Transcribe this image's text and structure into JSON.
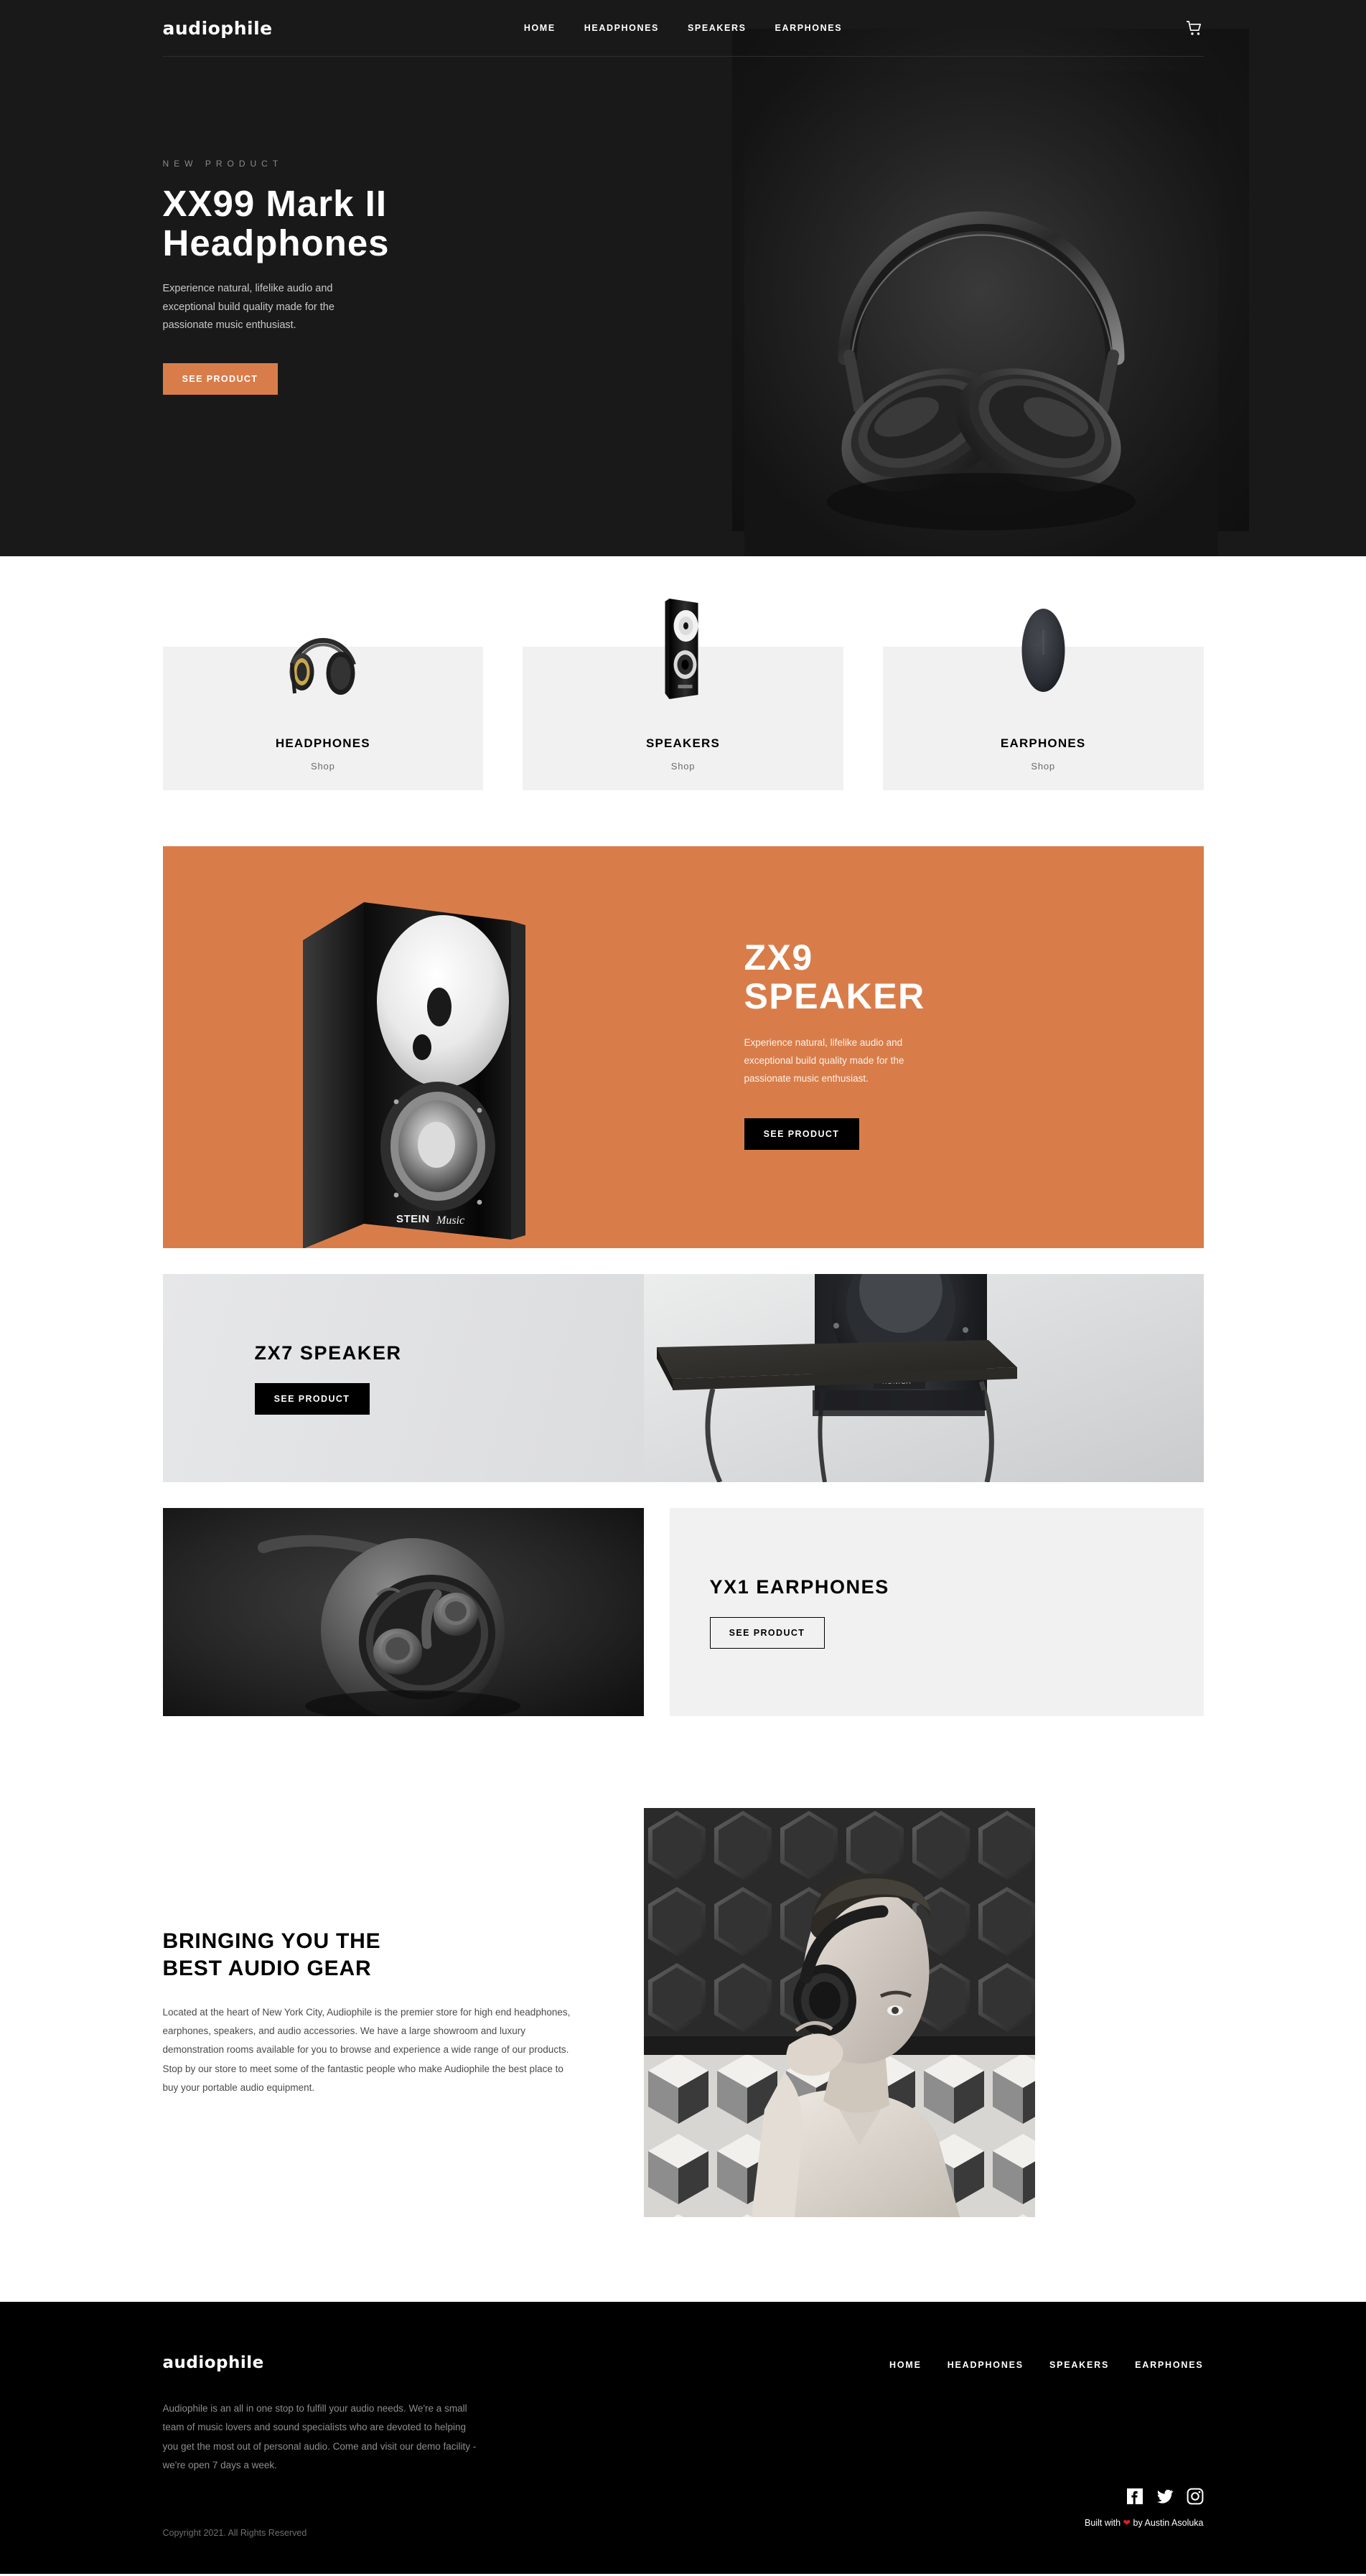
{
  "brand": {
    "name": "audiophile"
  },
  "header": {
    "nav": [
      {
        "label": "HOME"
      },
      {
        "label": "HEADPHONES"
      },
      {
        "label": "SPEAKERS"
      },
      {
        "label": "EARPHONES"
      }
    ],
    "cart_icon": "shopping-cart-icon"
  },
  "hero": {
    "overline": "NEW PRODUCT",
    "title_line1": "XX99 Mark II",
    "title_line2": "Headphones",
    "description": "Experience natural, lifelike audio and exceptional build quality made for the passionate music enthusiast.",
    "cta": "SEE PRODUCT",
    "cta_color": "#D87D4A",
    "background_color": "#191919",
    "image": "xx99-mark-ii-headphones-photo"
  },
  "categories": [
    {
      "name": "HEADPHONES",
      "shop": "Shop",
      "image": "headphones-product-image"
    },
    {
      "name": "SPEAKERS",
      "shop": "Shop",
      "image": "speaker-product-image"
    },
    {
      "name": "EARPHONES",
      "shop": "Shop",
      "image": "earphones-product-image"
    }
  ],
  "zx9": {
    "title_line1": "ZX9",
    "title_line2": "SPEAKER",
    "description": "Experience natural, lifelike audio and exceptional build quality made for the passionate music enthusiast.",
    "cta": "SEE PRODUCT",
    "background_color": "#D87D4A",
    "image": "zx9-speaker-photo",
    "image_brand": "STEIN Music"
  },
  "zx7": {
    "title": "ZX7 SPEAKER",
    "cta": "SEE PRODUCT",
    "image": "zx7-speaker-photo"
  },
  "yx1": {
    "title": "YX1 EARPHONES",
    "cta": "SEE PRODUCT",
    "image": "yx1-earphones-photo"
  },
  "about": {
    "title_line1": "BRINGING YOU THE",
    "title_line2": "BEST AUDIO GEAR",
    "text": "Located at the heart of New York City, Audiophile is the premier store for high end headphones, earphones, speakers, and audio accessories. We have a large showroom and luxury demonstration rooms available for you to browse and experience a wide range of our products. Stop by our store to meet some of the fantastic people who make Audiophile the best place to buy your portable audio equipment.",
    "image": "man-wearing-headphones-photo"
  },
  "footer": {
    "logo": "audiophile",
    "nav": [
      {
        "label": "HOME"
      },
      {
        "label": "HEADPHONES"
      },
      {
        "label": "SPEAKERS"
      },
      {
        "label": "EARPHONES"
      }
    ],
    "description": "Audiophile is an all in one stop to fulfill your audio needs. We're a small team of music lovers and sound specialists who are devoted to helping you get the most out of personal audio. Come and visit our demo facility - we're open 7 days a week.",
    "socials": [
      {
        "name": "facebook-icon"
      },
      {
        "name": "twitter-icon"
      },
      {
        "name": "instagram-icon"
      }
    ],
    "built_prefix": "Built with",
    "built_heart": "❤",
    "built_suffix": "by Austin Asoluka",
    "copyright": "Copyright 2021. All Rights Reserved"
  }
}
